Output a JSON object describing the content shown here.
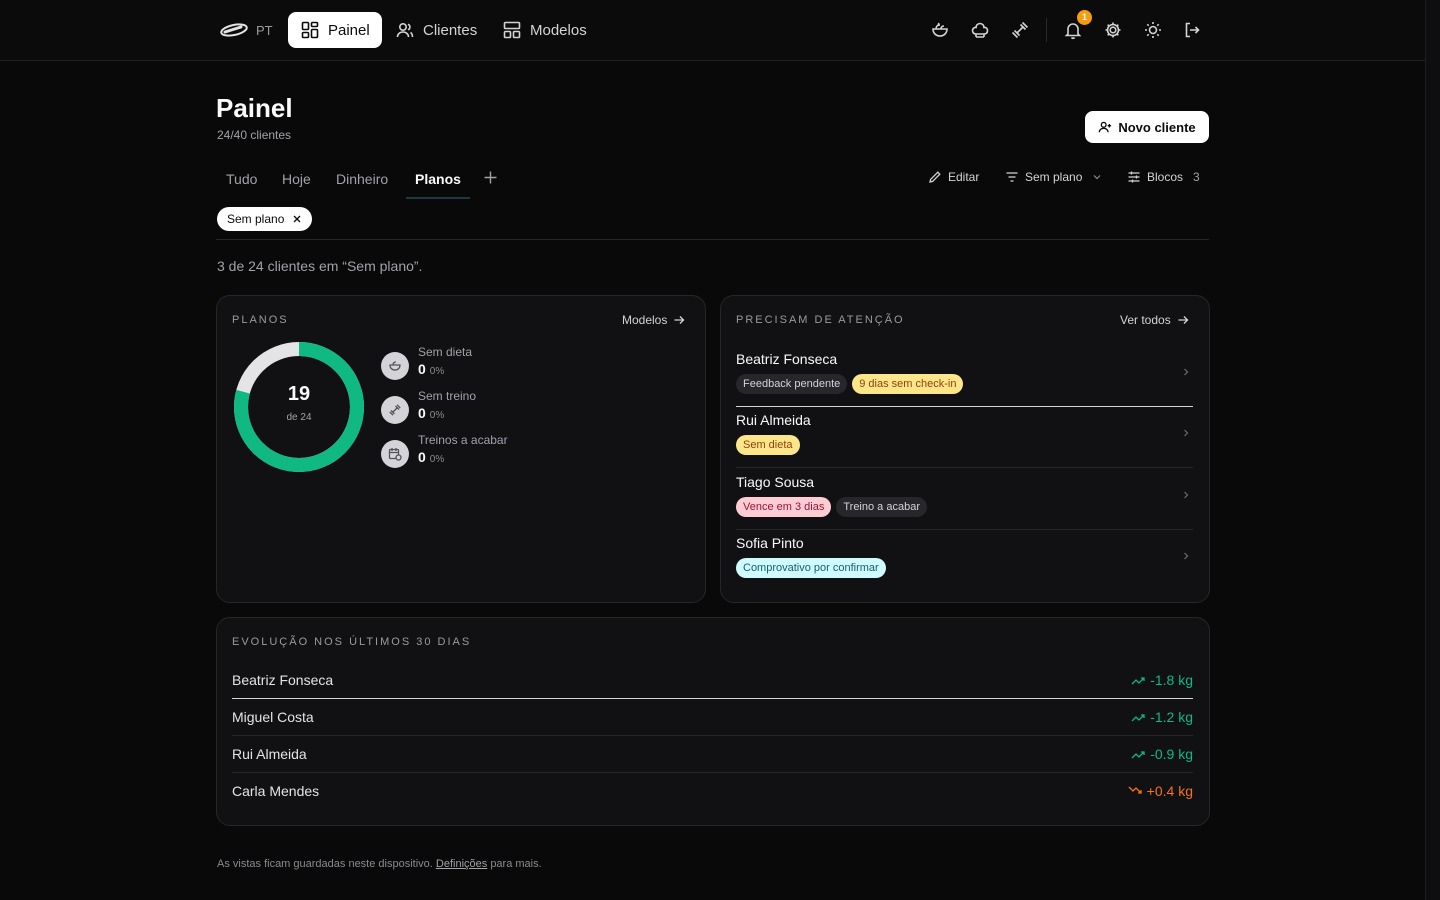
{
  "app": {
    "lang": "PT",
    "nav": [
      {
        "label": "Painel",
        "icon": "dashboard-icon",
        "active": true
      },
      {
        "label": "Clientes",
        "icon": "users-icon"
      },
      {
        "label": "Modelos",
        "icon": "templates-icon"
      }
    ],
    "notifications_count": "1"
  },
  "header": {
    "title": "Painel",
    "subtitle": "24/40 clientes",
    "new_client_label": "Novo cliente"
  },
  "tabs": [
    "Tudo",
    "Hoje",
    "Dinheiro",
    "Planos"
  ],
  "active_tab": "Planos",
  "actions": {
    "edit_label": "Editar",
    "filter_label": "Sem plano",
    "blocks_label": "Blocos",
    "blocks_count": "3"
  },
  "filter_chip": "Sem plano",
  "summary": "3 de 24 clientes em “Sem plano”.",
  "planos": {
    "title": "PLANOS",
    "link_label": "Modelos",
    "donut": {
      "value": "19",
      "sub": "de 24",
      "fraction": 0.7917
    },
    "stats": [
      {
        "label": "Sem dieta",
        "value": "0",
        "pct": "0%",
        "icon": "diet-icon"
      },
      {
        "label": "Sem treino",
        "value": "0",
        "pct": "0%",
        "icon": "dumbbell-icon"
      },
      {
        "label": "Treinos a acabar",
        "value": "0",
        "pct": "0%",
        "icon": "calendar-clock-icon"
      }
    ]
  },
  "attention": {
    "title": "PRECISAM DE ATENÇÃO",
    "link_label": "Ver todos",
    "rows": [
      {
        "name": "Beatriz Fonseca",
        "tags": [
          {
            "text": "Feedback pendente",
            "tone": "gray"
          },
          {
            "text": "9 dias sem check-in",
            "tone": "amber"
          }
        ]
      },
      {
        "name": "Rui Almeida",
        "tags": [
          {
            "text": "Sem dieta",
            "tone": "amber"
          }
        ]
      },
      {
        "name": "Tiago Sousa",
        "tags": [
          {
            "text": "Vence em 3 dias",
            "tone": "rose"
          },
          {
            "text": "Treino a acabar",
            "tone": "gray"
          }
        ]
      },
      {
        "name": "Sofia Pinto",
        "tags": [
          {
            "text": "Comprovativo por confirmar",
            "tone": "sky"
          }
        ]
      }
    ]
  },
  "evolution": {
    "title": "EVOLUÇÃO NOS ÚLTIMOS 30 DIAS",
    "rows": [
      {
        "name": "Beatriz Fonseca",
        "delta": "-1.8 kg",
        "trend": "down"
      },
      {
        "name": "Miguel Costa",
        "delta": "-1.2 kg",
        "trend": "down"
      },
      {
        "name": "Rui Almeida",
        "delta": "-0.9 kg",
        "trend": "down"
      },
      {
        "name": "Carla Mendes",
        "delta": "+0.4 kg",
        "trend": "up"
      }
    ]
  },
  "footer": {
    "text_before": "As vistas ficam guardadas neste dispositivo.",
    "link": "Definições",
    "text_after": "para mais."
  },
  "colors": {
    "accent_green": "#10b981",
    "warning_orange": "#f97316",
    "badge_amber": "#f59e0b"
  }
}
